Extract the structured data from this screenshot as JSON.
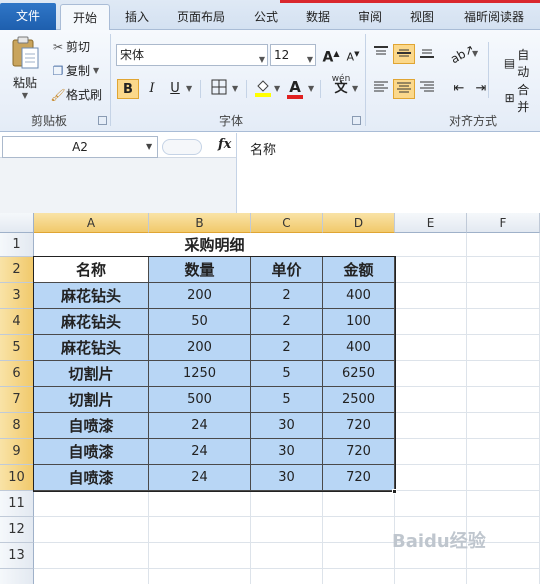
{
  "tabs": [
    "文件",
    "开始",
    "插入",
    "页面布局",
    "公式",
    "数据",
    "审阅",
    "视图",
    "福昕阅读器"
  ],
  "clipboard": {
    "paste_label": "粘贴",
    "cut_label": "剪切",
    "copy_label": "复制",
    "format_painter_label": "格式刷",
    "group_label": "剪贴板"
  },
  "font": {
    "name": "宋体",
    "size": "12",
    "grow": "A",
    "shrink": "A",
    "bold": "B",
    "italic": "I",
    "underline": "U",
    "color_letter": "A",
    "wen": "wén",
    "group_label": "字体"
  },
  "alignment": {
    "merge_label": "合并",
    "wrap_label": "自动",
    "group_label": "对齐方式"
  },
  "formula_bar": {
    "name_box": "A2",
    "fx": "fx",
    "content": "名称"
  },
  "columns": [
    "A",
    "B",
    "C",
    "D",
    "E",
    "F"
  ],
  "rows": [
    "1",
    "2",
    "3",
    "4",
    "5",
    "6",
    "7",
    "8",
    "9",
    "10",
    "11",
    "12",
    "13"
  ],
  "sheet": {
    "title": "采购明细",
    "header": [
      "名称",
      "数量",
      "单价",
      "金额"
    ],
    "data": [
      [
        "麻花钻头",
        "200",
        "2",
        "400"
      ],
      [
        "麻花钻头",
        "50",
        "2",
        "100"
      ],
      [
        "麻花钻头",
        "200",
        "2",
        "400"
      ],
      [
        "切割片",
        "1250",
        "5",
        "6250"
      ],
      [
        "切割片",
        "500",
        "5",
        "2500"
      ],
      [
        "自喷漆",
        "24",
        "30",
        "720"
      ],
      [
        "自喷漆",
        "24",
        "30",
        "720"
      ],
      [
        "自喷漆",
        "24",
        "30",
        "720"
      ]
    ]
  },
  "watermark": "Baidu经验"
}
